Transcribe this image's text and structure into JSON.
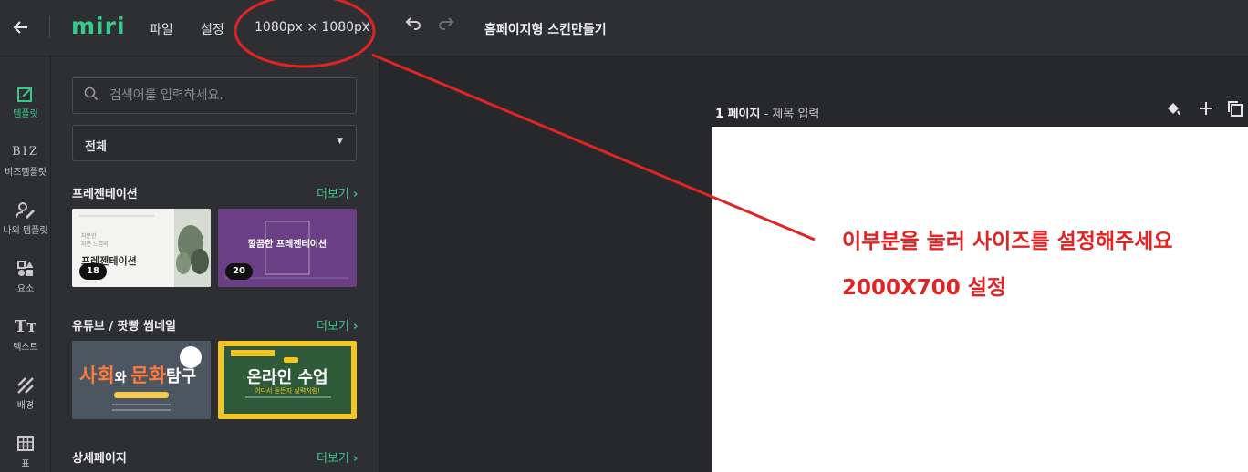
{
  "topbar": {
    "back_icon": "arrow-left-icon",
    "logo": "miri",
    "menu_file": "파일",
    "menu_settings": "설정",
    "size_label": "1080px × 1080px",
    "undo_icon": "undo-icon",
    "redo_icon": "redo-icon",
    "doc_title": "홈페이지형 스킨만들기"
  },
  "leftnav": {
    "items": [
      {
        "label": "템플릿",
        "icon": "template-icon",
        "glyph": "",
        "active": true
      },
      {
        "label": "비즈템플릿",
        "icon": "biz-icon",
        "glyph": "BIZ"
      },
      {
        "label": "나의 템플릿",
        "icon": "my-template-icon",
        "glyph": ""
      },
      {
        "label": "요소",
        "icon": "elements-icon",
        "glyph": ""
      },
      {
        "label": "텍스트",
        "icon": "text-icon",
        "glyph": "Tт"
      },
      {
        "label": "배경",
        "icon": "background-icon",
        "glyph": ""
      },
      {
        "label": "표",
        "icon": "table-icon",
        "glyph": ""
      }
    ]
  },
  "panel": {
    "search_placeholder": "검색어를 입력하세요.",
    "filter_value": "전체",
    "sections": [
      {
        "title": "프레젠테이션",
        "more": "더보기",
        "thumbs": [
          {
            "badge": "18",
            "lines": [
              "차분한",
              "자연 느낌의",
              "프레젠테이션"
            ]
          },
          {
            "badge": "20",
            "text": "깔끔한 프레젠테이션"
          }
        ]
      },
      {
        "title": "유튜브 / 팟빵 썸네일",
        "more": "더보기",
        "thumbs": [
          {
            "text_a": "사회",
            "text_b": "와 ",
            "text_c": "문화",
            "text_d": "탐구"
          },
          {
            "text": "온라인 수업",
            "sub": "어디서 듣든지 실력처럼!"
          }
        ]
      },
      {
        "title": "상세페이지",
        "more": "더보기"
      }
    ]
  },
  "canvas": {
    "page_number": "1 페이지",
    "page_title_placeholder": "- 제목 입력",
    "tools": [
      "paint-bucket-icon",
      "plus-icon",
      "copy-icon"
    ]
  },
  "annotation": {
    "line1": "이부분을 눌러 사이즈를 설정해주세요",
    "line2": "2000X700 설정",
    "color": "#e02424"
  }
}
